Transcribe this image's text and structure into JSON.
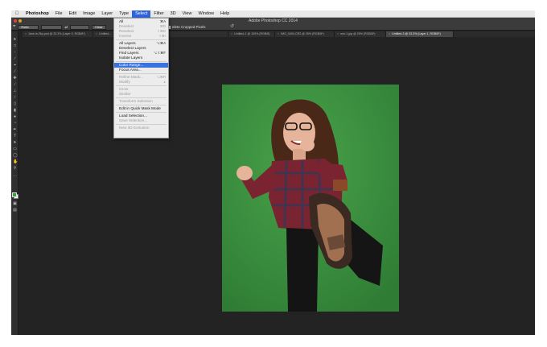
{
  "menubar": {
    "app": "Photoshop",
    "items": [
      "File",
      "Edit",
      "Image",
      "Layer",
      "Type",
      "Select",
      "Filter",
      "3D",
      "View",
      "Window",
      "Help"
    ],
    "active_index": 5
  },
  "window": {
    "title": "Adobe Photoshop CC 2014"
  },
  "options_bar": {
    "ratio_value": "Ratio",
    "swap_icon": "swap-icon",
    "clear_label": "Clear",
    "delete_cropped_label": "elete Cropped Pixels"
  },
  "tabs": [
    {
      "label": "Jane-in-Sky.psd @ 33.3% (Layer 0, RGB/8*)"
    },
    {
      "label": "Untitled..."
    },
    {
      "label": "...city - 634-768.jpg @ 100% (RGB/8#)"
    },
    {
      "label": "Untitled-1 @ 100% (RGB/8)"
    },
    {
      "label": "IMG_0494-CR2 @ 25% (RGB/8*)"
    },
    {
      "label": "one-1.jpg @ 25% (RGB/8*)"
    },
    {
      "label": "Untitled-3 @ 33.3% (Layer 1, RGB/8*)"
    }
  ],
  "select_menu": {
    "items": [
      {
        "label": "All",
        "shortcut": "⌘A",
        "disabled": false
      },
      {
        "label": "Deselect",
        "shortcut": "⌘D",
        "disabled": true
      },
      {
        "label": "Reselect",
        "shortcut": "⇧⌘D",
        "disabled": true
      },
      {
        "label": "Inverse",
        "shortcut": "⇧⌘I",
        "disabled": true
      },
      {
        "label": "All Layers",
        "shortcut": "⌥⌘A",
        "disabled": false
      },
      {
        "label": "Deselect Layers",
        "shortcut": "",
        "disabled": false
      },
      {
        "label": "Find Layers",
        "shortcut": "⌥⇧⌘F",
        "disabled": false
      },
      {
        "label": "Isolate Layers",
        "shortcut": "",
        "disabled": false
      },
      {
        "label": "Color Range...",
        "shortcut": "",
        "disabled": false,
        "highlighted": true
      },
      {
        "label": "Focus Area...",
        "shortcut": "",
        "disabled": false
      },
      {
        "label": "Refine Mask...",
        "shortcut": "⌥⌘R",
        "disabled": true
      },
      {
        "label": "Modify",
        "shortcut": "▸",
        "disabled": true
      },
      {
        "label": "Grow",
        "shortcut": "",
        "disabled": true
      },
      {
        "label": "Similar",
        "shortcut": "",
        "disabled": true
      },
      {
        "label": "Transform Selection",
        "shortcut": "",
        "disabled": true
      },
      {
        "label": "Edit in Quick Mask Mode",
        "shortcut": "",
        "disabled": false
      },
      {
        "label": "Load Selection...",
        "shortcut": "",
        "disabled": false
      },
      {
        "label": "Save Selection...",
        "shortcut": "",
        "disabled": true
      },
      {
        "label": "New 3D Extrusion",
        "shortcut": "",
        "disabled": true
      }
    ]
  },
  "colors": {
    "menu_highlight": "#3a72de",
    "foreground": "#3aa040",
    "background": "#ffffff",
    "backdrop_green": "#3a8e3d"
  }
}
